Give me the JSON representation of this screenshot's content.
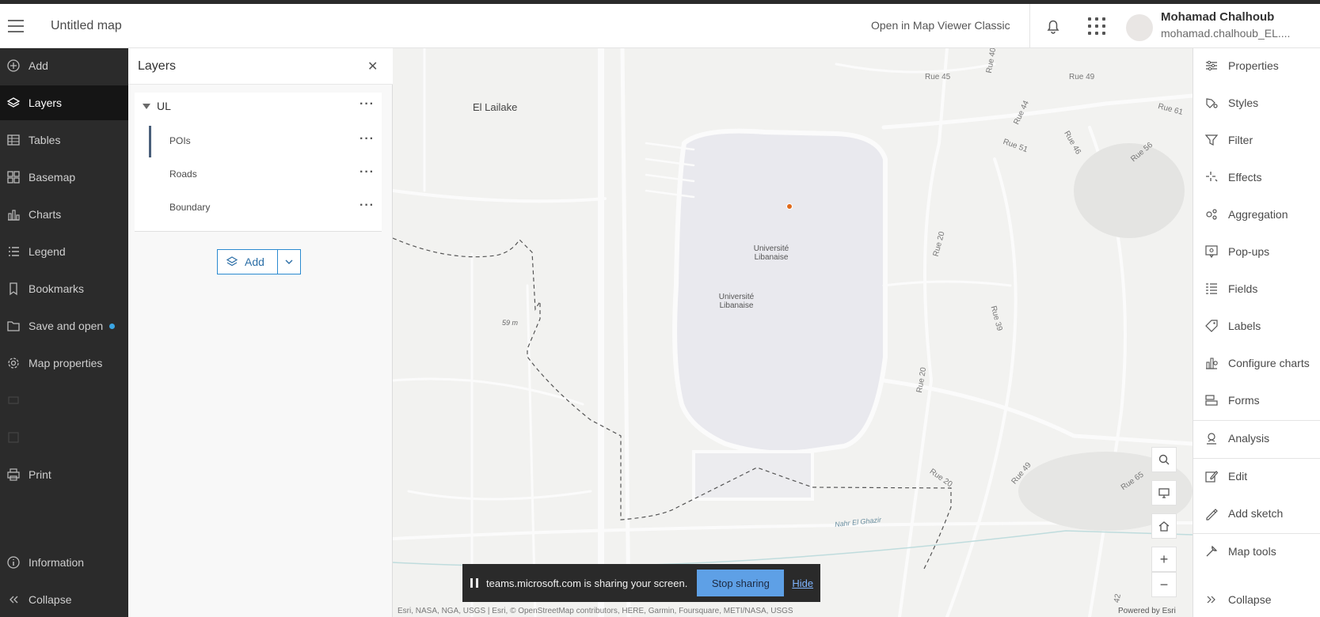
{
  "header": {
    "map_title": "Untitled map",
    "open_classic": "Open in Map Viewer Classic",
    "user_name": "Mohamad Chalhoub",
    "user_handle": "mohamad.chalhoub_EL...."
  },
  "leftnav": {
    "items": [
      {
        "label": "Add",
        "icon": "plus-circle-icon"
      },
      {
        "label": "Layers",
        "icon": "layers-icon",
        "active": true
      },
      {
        "label": "Tables",
        "icon": "table-icon"
      },
      {
        "label": "Basemap",
        "icon": "basemap-icon"
      },
      {
        "label": "Charts",
        "icon": "chart-icon"
      },
      {
        "label": "Legend",
        "icon": "legend-icon"
      },
      {
        "label": "Bookmarks",
        "icon": "bookmark-icon"
      },
      {
        "label": "Save and open",
        "icon": "folder-icon",
        "badge": true
      },
      {
        "label": "Map properties",
        "icon": "gear-icon"
      },
      {
        "label": "Print",
        "icon": "printer-icon"
      }
    ],
    "information": "Information",
    "collapse": "Collapse"
  },
  "layers_panel": {
    "title": "Layers",
    "group": "UL",
    "layers": [
      "POIs",
      "Roads",
      "Boundary"
    ],
    "add_label": "Add"
  },
  "map": {
    "labels": {
      "el_lailake": "El Lailake",
      "univ1": "Université Libanaise",
      "univ2": "Université Libanaise",
      "elevation": "59 m",
      "river": "Nahr El Ghazir",
      "rue45": "Rue 45",
      "rue49a": "Rue 49",
      "rue40": "Rue 40",
      "rue61": "Rue 61",
      "rue44": "Rue 44",
      "rue51": "Rue 51",
      "rue46": "Rue 46",
      "rue56": "Rue 56",
      "rue20a": "Rue 20",
      "rue39": "Rue 39",
      "rue20b": "Rue 20",
      "rue20c": "Rue 20",
      "rue49b": "Rue 49",
      "rue65": "Rue 65",
      "rue42": "42"
    },
    "attribution": "Esri, NASA, NGA, USGS | Esri, © OpenStreetMap contributors, HERE, Garmin, Foursquare, METI/NASA, USGS",
    "powered_by": "Powered by Esri"
  },
  "share_bar": {
    "text": "teams.microsoft.com is sharing your screen.",
    "stop": "Stop sharing",
    "hide": "Hide"
  },
  "rightpanel": {
    "items": [
      {
        "label": "Properties",
        "icon": "properties-icon"
      },
      {
        "label": "Styles",
        "icon": "styles-icon"
      },
      {
        "label": "Filter",
        "icon": "filter-icon"
      },
      {
        "label": "Effects",
        "icon": "effects-icon"
      },
      {
        "label": "Aggregation",
        "icon": "aggregation-icon"
      },
      {
        "label": "Pop-ups",
        "icon": "popup-icon"
      },
      {
        "label": "Fields",
        "icon": "fields-icon"
      },
      {
        "label": "Labels",
        "icon": "labels-icon"
      },
      {
        "label": "Configure charts",
        "icon": "configure-charts-icon"
      },
      {
        "label": "Forms",
        "icon": "forms-icon"
      },
      {
        "label": "Analysis",
        "icon": "analysis-icon"
      },
      {
        "label": "Edit",
        "icon": "edit-icon"
      },
      {
        "label": "Add sketch",
        "icon": "sketch-icon"
      },
      {
        "label": "Map tools",
        "icon": "map-tools-icon"
      }
    ],
    "collapse": "Collapse"
  },
  "colors": {
    "nav_bg": "#2b2b2b",
    "accent": "#2b8ad0",
    "poi": "#e06a1a",
    "badge": "#3aa5e3"
  }
}
